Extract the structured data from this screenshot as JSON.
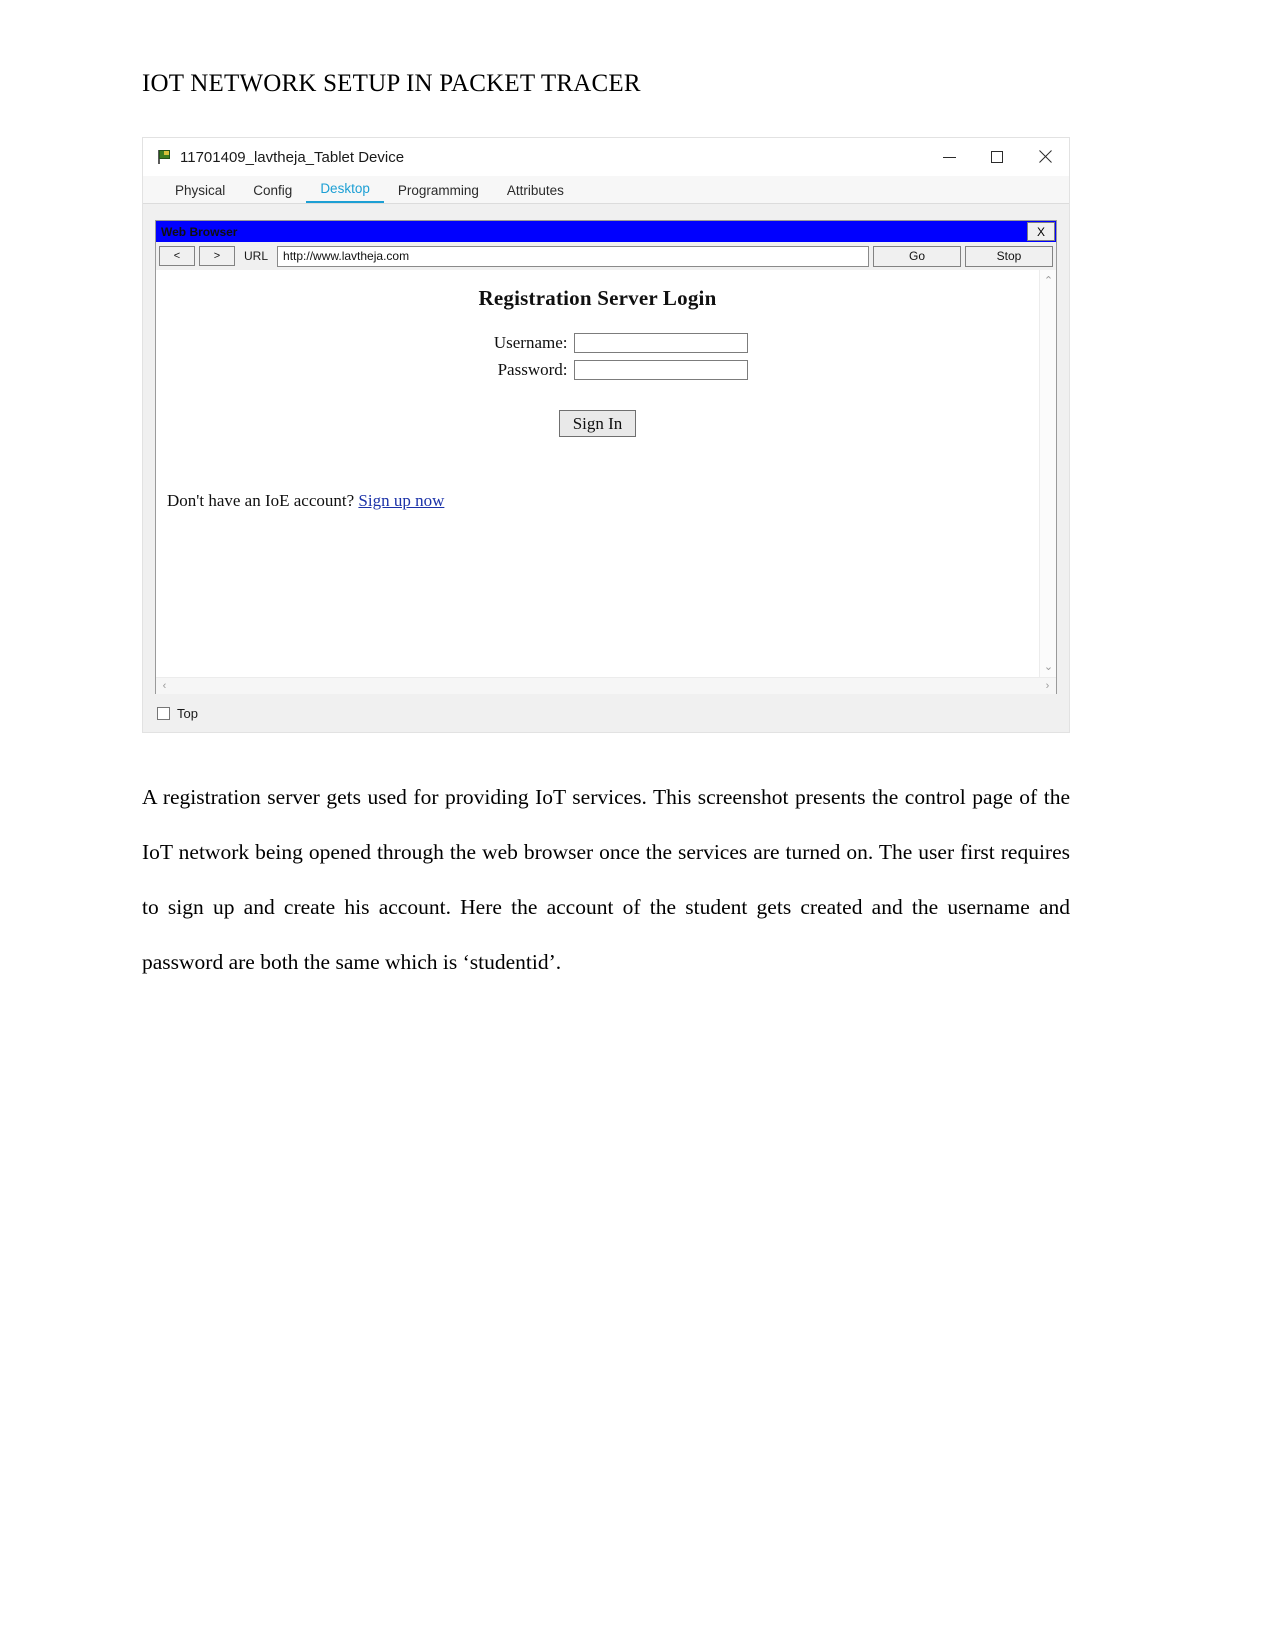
{
  "document": {
    "title": "IOT NETWORK SETUP IN PACKET TRACER",
    "paragraph": "A registration server gets used for providing IoT services. This screenshot presents the control page of the IoT network being opened through the web browser once the services are turned on. The user first requires to sign up and create his account. Here the account of the student gets created and the username and password are both the same which is ‘studentid’."
  },
  "window": {
    "title": "11701409_lavtheja_Tablet Device",
    "icon": "packet-tracer-device-icon",
    "controls": {
      "minimize": "—",
      "maximize": "□",
      "close": "✕"
    },
    "tabs": [
      {
        "label": "Physical",
        "active": false
      },
      {
        "label": "Config",
        "active": false
      },
      {
        "label": "Desktop",
        "active": true
      },
      {
        "label": "Programming",
        "active": false
      },
      {
        "label": "Attributes",
        "active": false
      }
    ],
    "footer": {
      "top_checkbox_label": "Top",
      "top_checkbox_checked": false
    }
  },
  "browser": {
    "title": "Web Browser",
    "close_label": "X",
    "titlebar_color": "#0000ff",
    "toolbar": {
      "back_label": "<",
      "forward_label": ">",
      "url_label": "URL",
      "url_value": "http://www.lavtheja.com",
      "go_label": "Go",
      "stop_label": "Stop"
    },
    "scrollbars": {
      "vertical_up": "⌃",
      "vertical_down": "⌄",
      "horizontal_left": "‹",
      "horizontal_right": "›"
    }
  },
  "login_page": {
    "heading": "Registration Server Login",
    "fields": [
      {
        "label": "Username:",
        "value": "",
        "type": "text"
      },
      {
        "label": "Password:",
        "value": "",
        "type": "password"
      }
    ],
    "submit_label": "Sign In",
    "signup_prompt": "Don't have an IoE account?",
    "signup_link": "Sign up now",
    "link_color": "#1b32a8"
  }
}
